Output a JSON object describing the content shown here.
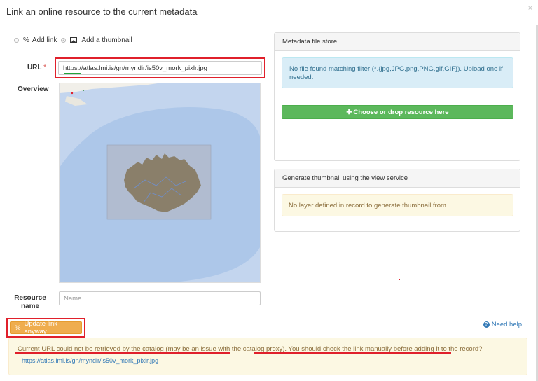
{
  "dialog": {
    "title": "Link an online resource to the current metadata",
    "close_label": "×"
  },
  "mode": {
    "options": [
      {
        "label": "Add link",
        "icon": "link-icon",
        "selected": false
      },
      {
        "label": "Add a thumbnail",
        "icon": "image-icon",
        "selected": true
      }
    ]
  },
  "form": {
    "url_label": "URL",
    "url_required_mark": "*",
    "url_value": "https://atlas.lmi.is/gn/myndir/is50v_mork_pixlr.jpg",
    "overview_label": "Overview",
    "resource_name_label_line1": "Resource",
    "resource_name_label_line2": "name",
    "resource_name_placeholder": "Name"
  },
  "actions": {
    "update_label": "Update link anyway",
    "need_help_label": "Need help"
  },
  "warning": {
    "message": "Current URL could not be retrieved by the catalog (may be an issue with the catalog proxy). You should check the link manually before adding it to the record?",
    "url": "https://atlas.lmi.is/gn/myndir/is50v_mork_pixlr.jpg"
  },
  "file_store": {
    "heading": "Metadata file store",
    "info": "No file found matching filter (*.{jpg,JPG,png,PNG,gif,GIF}). Upload one if needed.",
    "choose_label": "Choose or drop resource here"
  },
  "thumbnail_service": {
    "heading": "Generate thumbnail using the view service",
    "message": "No layer defined in record to generate thumbnail from"
  },
  "colors": {
    "highlight": "#e0202b",
    "success": "#5cb85c",
    "warning_button": "#efad4e",
    "info_bg": "#d9edf7",
    "map_water": "#a7c3e6",
    "map_land": "#8a7f6a"
  }
}
